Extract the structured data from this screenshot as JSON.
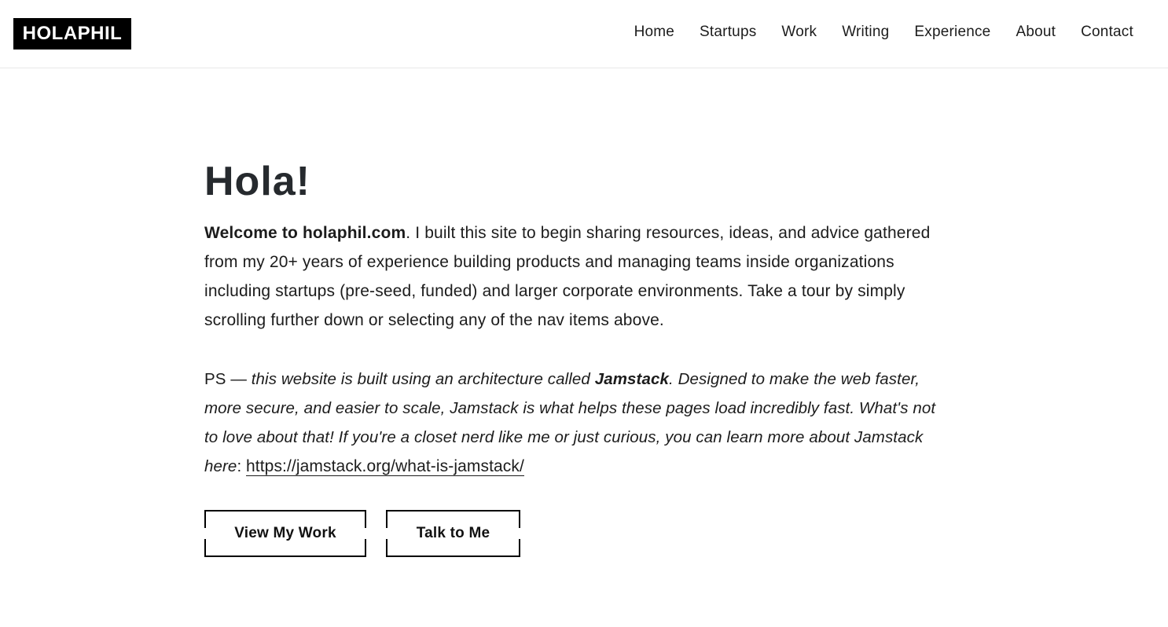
{
  "logo": "HOLAPHIL",
  "nav": {
    "items": [
      "Home",
      "Startups",
      "Work",
      "Writing",
      "Experience",
      "About",
      "Contact"
    ]
  },
  "hero": {
    "title": "Hola!",
    "intro_bold": "Welcome to holaphil.com",
    "intro_rest": ". I built this site to begin sharing resources, ideas, and advice gathered from my 20+ years of experience building products and managing teams inside organizations including startups (pre-seed, funded) and larger corporate environments. Take a tour by simply scrolling further down or selecting any of the nav items above.",
    "ps_prefix": "PS — ",
    "ps_italic_1": "this website is built using an architecture called ",
    "ps_bold": "Jamstack",
    "ps_italic_2": ". Designed to make the web faster, more secure, and easier to scale, Jamstack is what helps these pages load incredibly fast. What's not to love about that! If you're a closet nerd like me or just curious, you can learn more about Jamstack here",
    "ps_colon": ": ",
    "ps_link": "https://jamstack.org/what-is-jamstack/"
  },
  "buttons": {
    "view_work": "View My Work",
    "talk": "Talk to Me"
  }
}
